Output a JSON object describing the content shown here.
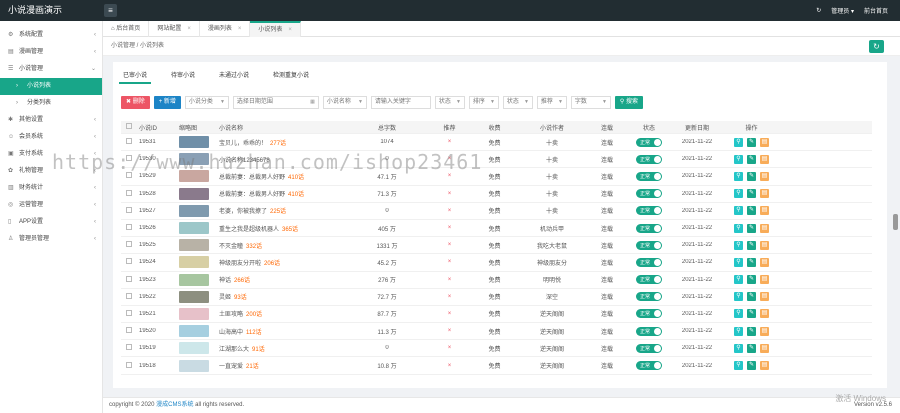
{
  "app": {
    "title": "小说漫画演示",
    "menu_icon": "hamburger-icon"
  },
  "topbar": {
    "admin_label": "管理员",
    "frontend_label": "前台首页"
  },
  "sidebar": {
    "items": [
      {
        "label": "系统配置",
        "icon": "gear-icon",
        "has_chevron": true
      },
      {
        "label": "漫画管理",
        "icon": "book-icon",
        "has_chevron": true
      },
      {
        "label": "小说管理",
        "icon": "list-icon",
        "has_chevron": true,
        "expanded": true
      },
      {
        "label": "小说列表",
        "icon": "chevron-right-icon",
        "sub": true,
        "active": true
      },
      {
        "label": "分类列表",
        "icon": "chevron-right-icon",
        "sub": true
      },
      {
        "label": "其他设置",
        "icon": "cog-icon",
        "has_chevron": true
      },
      {
        "label": "会员系统",
        "icon": "user-icon",
        "has_chevron": true
      },
      {
        "label": "支付系统",
        "icon": "wallet-icon",
        "has_chevron": true
      },
      {
        "label": "礼物管理",
        "icon": "gift-icon",
        "has_chevron": true
      },
      {
        "label": "财务统计",
        "icon": "chart-icon",
        "has_chevron": true
      },
      {
        "label": "运营管理",
        "icon": "target-icon",
        "has_chevron": true
      },
      {
        "label": "APP设置",
        "icon": "phone-icon",
        "has_chevron": true
      },
      {
        "label": "管理员管理",
        "icon": "admin-icon",
        "has_chevron": true
      }
    ]
  },
  "tabs": [
    {
      "label": "后台首页",
      "closable": false
    },
    {
      "label": "网站配置",
      "closable": true
    },
    {
      "label": "漫画列表",
      "closable": true
    },
    {
      "label": "小说列表",
      "closable": true,
      "active": true
    }
  ],
  "breadcrumb": {
    "parent": "小说管理",
    "current": "小说列表",
    "sep": " / "
  },
  "subtabs": [
    "已审小说",
    "待审小说",
    "未通过小说",
    "检测重复小说"
  ],
  "toolbar": {
    "delete_label": "删除",
    "add_label": "+ 新增",
    "category_placeholder": "小说分类",
    "date_placeholder": "选择日期范围",
    "field_label": "小说名称",
    "keyword_placeholder": "请输入关键字",
    "status_label": "状态",
    "order_label": "排序",
    "finish_label": "状态",
    "recommend_label": "推荐",
    "wordcount_label": "字数",
    "search_label": "搜索"
  },
  "table": {
    "columns": [
      "小说ID",
      "缩略图",
      "小说名称",
      "总字数",
      "推荐",
      "收费",
      "小说作者",
      "连载",
      "状态",
      "更新日期",
      "操作"
    ],
    "rows": [
      {
        "id": "19531",
        "name": "宝贝儿，乖乖的！",
        "chapters": "277话",
        "words": "1074",
        "recommend": "×",
        "fee": "免费",
        "author": "十卖",
        "serial": "连载",
        "status": "正常",
        "date": "2021-11-22",
        "thumb": "#6f8fa8"
      },
      {
        "id": "19530",
        "name": "小说名称12345678",
        "chapters": "",
        "words": "0",
        "recommend": "×",
        "fee": "免费",
        "author": "十卖",
        "serial": "连载",
        "status": "正常",
        "date": "2021-11-22",
        "thumb": "#8aa0b5"
      },
      {
        "id": "19529",
        "name": "总裁前妻：总裁男人好野",
        "chapters": "410话",
        "words": "47.1 万",
        "recommend": "×",
        "fee": "免费",
        "author": "十卖",
        "serial": "连载",
        "status": "正常",
        "date": "2021-11-22",
        "thumb": "#c9a7a0"
      },
      {
        "id": "19528",
        "name": "总裁前妻：总裁男人好野",
        "chapters": "410话",
        "words": "71.3 万",
        "recommend": "×",
        "fee": "免费",
        "author": "十卖",
        "serial": "连载",
        "status": "正常",
        "date": "2021-11-22",
        "thumb": "#8a7a8c"
      },
      {
        "id": "19527",
        "name": "老婆，你被我撩了",
        "chapters": "225话",
        "words": "0",
        "recommend": "×",
        "fee": "免费",
        "author": "十卖",
        "serial": "连载",
        "status": "正常",
        "date": "2021-11-22",
        "thumb": "#7f9aae"
      },
      {
        "id": "19526",
        "name": "重生之我是超级机器人",
        "chapters": "365话",
        "words": "405 万",
        "recommend": "×",
        "fee": "免费",
        "author": "机动兵甲",
        "serial": "连载",
        "status": "正常",
        "date": "2021-11-22",
        "thumb": "#9cc7c9"
      },
      {
        "id": "19525",
        "name": "不灭金瞳",
        "chapters": "332话",
        "words": "1331 万",
        "recommend": "×",
        "fee": "免费",
        "author": "我吃大老鼠",
        "serial": "连载",
        "status": "正常",
        "date": "2021-11-22",
        "thumb": "#b8b2a6"
      },
      {
        "id": "19524",
        "name": "神级朋友分开啦",
        "chapters": "206话",
        "words": "45.2 万",
        "recommend": "×",
        "fee": "免费",
        "author": "神级朋友分",
        "serial": "连载",
        "status": "正常",
        "date": "2021-11-22",
        "thumb": "#d7cfa4"
      },
      {
        "id": "19523",
        "name": "神话",
        "chapters": "266话",
        "words": "276 万",
        "recommend": "×",
        "fee": "免费",
        "author": "明明悦",
        "serial": "连载",
        "status": "正常",
        "date": "2021-11-22",
        "thumb": "#a7c6a0"
      },
      {
        "id": "19522",
        "name": "灵姬",
        "chapters": "93话",
        "words": "72.7 万",
        "recommend": "×",
        "fee": "免费",
        "author": "深空",
        "serial": "连载",
        "status": "正常",
        "date": "2021-11-22",
        "thumb": "#8d8f80"
      },
      {
        "id": "19521",
        "name": "土匪攻略",
        "chapters": "200话",
        "words": "87.7 万",
        "recommend": "×",
        "fee": "免费",
        "author": "逆天阁阁",
        "serial": "连载",
        "status": "正常",
        "date": "2021-11-22",
        "thumb": "#e7c1c9"
      },
      {
        "id": "19520",
        "name": "山海高中",
        "chapters": "112话",
        "words": "11.3 万",
        "recommend": "×",
        "fee": "免费",
        "author": "逆天阁阁",
        "serial": "连载",
        "status": "正常",
        "date": "2021-11-22",
        "thumb": "#a6cfe0"
      },
      {
        "id": "19519",
        "name": "江湖那么大",
        "chapters": "91话",
        "words": "0",
        "recommend": "×",
        "fee": "免费",
        "author": "逆天阁阁",
        "serial": "连载",
        "status": "正常",
        "date": "2021-11-22",
        "thumb": "#cde7ea"
      },
      {
        "id": "19518",
        "name": "一直宠爱",
        "chapters": "21话",
        "words": "10.8 万",
        "recommend": "×",
        "fee": "免费",
        "author": "逆天阁阁",
        "serial": "连载",
        "status": "正常",
        "date": "2021-11-22",
        "thumb": "#c9dbe3"
      }
    ]
  },
  "footer": {
    "copyright": "copyright © 2020 ",
    "brand": "漫成CMS系统",
    "rights": " all rights reserved.",
    "version": "Version v2.5.6"
  },
  "overlay": {
    "watermark": "https://www.huzhan.com/ishop23461",
    "windows": "激活 Windows"
  },
  "colors": {
    "accent": "#18a689",
    "danger": "#ed5565",
    "primary": "#1c84c6",
    "warning": "#f8ac59",
    "info": "#23c6c8",
    "chapter": "#ff6600"
  }
}
